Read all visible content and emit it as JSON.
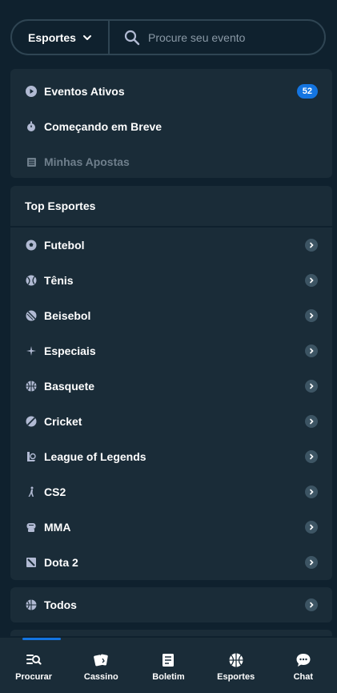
{
  "search": {
    "sport_select_label": "Esportes",
    "placeholder": "Procure seu evento"
  },
  "quick_links": [
    {
      "label": "Eventos Ativos",
      "icon": "play-circle-icon",
      "badge": "52"
    },
    {
      "label": "Começando em Breve",
      "icon": "stopwatch-icon"
    },
    {
      "label": "Minhas Apostas",
      "icon": "betslip-icon",
      "disabled": true
    }
  ],
  "top_sports": {
    "heading": "Top Esportes",
    "items": [
      {
        "label": "Futebol",
        "icon": "soccer-ball-icon"
      },
      {
        "label": "Tênis",
        "icon": "tennis-ball-icon"
      },
      {
        "label": "Beisebol",
        "icon": "baseball-icon"
      },
      {
        "label": "Especiais",
        "icon": "sparkle-icon"
      },
      {
        "label": "Basquete",
        "icon": "basketball-icon"
      },
      {
        "label": "Cricket",
        "icon": "cricket-ball-icon"
      },
      {
        "label": "League of Legends",
        "icon": "league-of-legends-icon"
      },
      {
        "label": "CS2",
        "icon": "cs2-icon"
      },
      {
        "label": "MMA",
        "icon": "mma-glove-icon"
      },
      {
        "label": "Dota 2",
        "icon": "dota2-icon"
      }
    ]
  },
  "all_sports": {
    "label": "Todos",
    "icon": "all-sports-icon"
  },
  "bottom_nav": {
    "active": "Procurar",
    "items": [
      {
        "label": "Procurar",
        "icon": "browse-search-icon"
      },
      {
        "label": "Cassino",
        "icon": "cards-icon"
      },
      {
        "label": "Boletim",
        "icon": "betslip-icon"
      },
      {
        "label": "Esportes",
        "icon": "basketball-icon"
      },
      {
        "label": "Chat",
        "icon": "chat-bubble-icon"
      }
    ]
  },
  "colors": {
    "background": "#0f212e",
    "card": "#1a2c38",
    "border": "#2f4553",
    "accent": "#1475e1",
    "muted_text": "#8a99a6"
  }
}
